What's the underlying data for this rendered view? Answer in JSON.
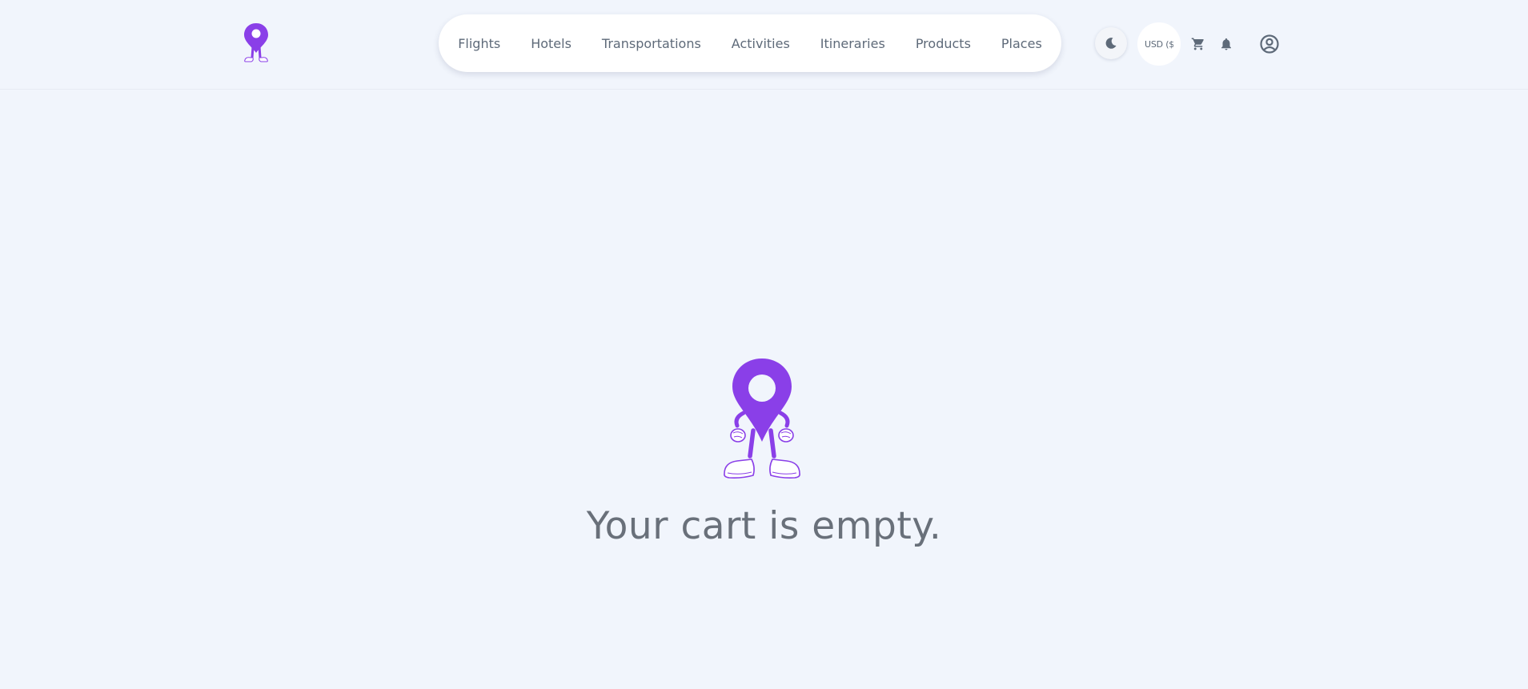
{
  "brand": {
    "logo_icon": "map-pin-mascot-icon",
    "accent_color": "#8a3fe8"
  },
  "nav": {
    "items": [
      {
        "label": "Flights"
      },
      {
        "label": "Hotels"
      },
      {
        "label": "Transportations"
      },
      {
        "label": "Activities"
      },
      {
        "label": "Itineraries"
      },
      {
        "label": "Products"
      },
      {
        "label": "Places"
      }
    ]
  },
  "toolbar": {
    "theme_icon": "moon-icon",
    "currency_label": "USD ($",
    "cart_icon": "cart-icon",
    "notifications_icon": "bell-icon",
    "account_icon": "user-circle-icon"
  },
  "cart": {
    "empty_message": "Your cart is empty.",
    "illustration_icon": "map-pin-mascot-icon"
  },
  "colors": {
    "background": "#f1f5fc",
    "text_muted": "#69707a",
    "icon_gray": "#5e6a79"
  }
}
